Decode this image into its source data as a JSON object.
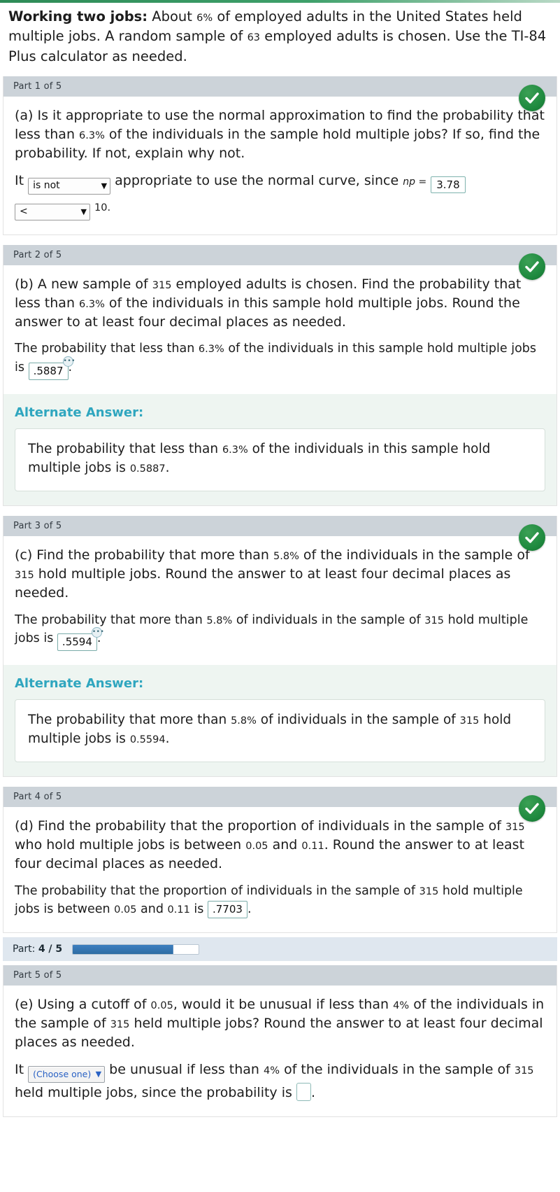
{
  "problem": {
    "title": "Working two jobs:",
    "text_1": "About",
    "percent": "6%",
    "text_2": "of employed adults in the United States held multiple jobs. A random sample of",
    "sample_size": "63",
    "text_3": "employed adults is chosen. Use the TI-84 Plus calculator as needed."
  },
  "parts": [
    {
      "header": "Part 1 of 5",
      "status": "correct",
      "question_prefix": "(a) Is it appropriate to use the normal approximation to find the probability that less than",
      "question_value": "6.3%",
      "question_suffix": "of the individuals in the sample hold multiple jobs? If so, find the probability. If not, explain why not.",
      "answer_lead": "It",
      "select_1_value": "is not",
      "answer_mid": "appropriate to use the normal curve, since",
      "np_symbol": "np =",
      "np_value": "3.78",
      "select_2_value": "<",
      "answer_tail": "10."
    },
    {
      "header": "Part 2 of 5",
      "status": "correct",
      "question_prefix": "(b) A new sample of",
      "question_n": "315",
      "question_mid": "employed adults is chosen. Find the probability that less than",
      "question_value": "6.3%",
      "question_suffix": "of the individuals in this sample hold multiple jobs. Round the answer to at least four decimal places as needed.",
      "answer_prefix": "The probability that less than",
      "answer_value_pct": "6.3%",
      "answer_mid": "of the individuals in this sample hold multiple jobs is",
      "answer_box": ".5887",
      "answer_tail": ".",
      "alternate_title": "Alternate Answer:",
      "alt_prefix": "The probability that less than",
      "alt_pct": "6.3%",
      "alt_mid": "of the individuals in this sample hold multiple jobs is",
      "alt_value": "0.5887",
      "alt_tail": "."
    },
    {
      "header": "Part 3 of 5",
      "status": "correct",
      "question_prefix": "(c) Find the probability that more than",
      "question_value": "5.8%",
      "question_mid": "of the individuals in the sample of",
      "question_n": "315",
      "question_suffix": "hold multiple jobs. Round the answer to at least four decimal places as needed.",
      "answer_prefix": "The probability that more than",
      "answer_value_pct": "5.8%",
      "answer_mid": "of individuals in the sample of",
      "answer_n": "315",
      "answer_mid2": "hold multiple jobs is",
      "answer_box": ".5594",
      "answer_tail": ".",
      "alternate_title": "Alternate Answer:",
      "alt_prefix": "The probability that more than",
      "alt_pct": "5.8%",
      "alt_mid": "of individuals in the sample of",
      "alt_n": "315",
      "alt_mid2": "hold multiple jobs is",
      "alt_value": "0.5594",
      "alt_tail": "."
    },
    {
      "header": "Part 4 of 5",
      "status": "correct",
      "question_prefix": "(d) Find the probability that the proportion of individuals in the sample of",
      "question_n": "315",
      "question_mid": "who hold multiple jobs is between",
      "question_lo": "0.05",
      "question_and": "and",
      "question_hi": "0.11",
      "question_suffix": ". Round the answer to at least four decimal places as needed.",
      "answer_prefix": "The probability that the proportion of individuals in the sample of",
      "answer_n": "315",
      "answer_mid": "hold multiple jobs is between",
      "answer_lo": "0.05",
      "answer_and": "and",
      "answer_hi": "0.11",
      "answer_is": "is",
      "answer_box": ".7703",
      "answer_tail": "."
    },
    {
      "header": "Part 5 of 5",
      "status": "pending",
      "question_prefix": "(e) Using a cutoff of",
      "question_cutoff": "0.05",
      "question_mid": ", would it be unusual if less than",
      "question_pct": "4%",
      "question_mid2": "of the individuals in the sample of",
      "question_n": "315",
      "question_suffix": "held multiple jobs? Round the answer to at least four decimal places as needed.",
      "answer_lead": "It",
      "select_placeholder": "(Choose one)",
      "answer_mid": "be unusual if less than",
      "answer_pct": "4%",
      "answer_mid2": "of the individuals in the sample of",
      "answer_n": "315",
      "answer_mid3": "held multiple jobs, since the probability is",
      "answer_tail": "."
    }
  ],
  "progress": {
    "label_prefix": "Part:",
    "current": "4 / 5",
    "percent": 80
  },
  "icons": {
    "check": "check-icon",
    "caret": "▼",
    "dots": "•••"
  },
  "colors": {
    "accent_green": "#1f8a3f",
    "alt_title": "#2fa6bf",
    "progress_blue": "#2e6da4",
    "header_gray": "#ccd3d9"
  }
}
